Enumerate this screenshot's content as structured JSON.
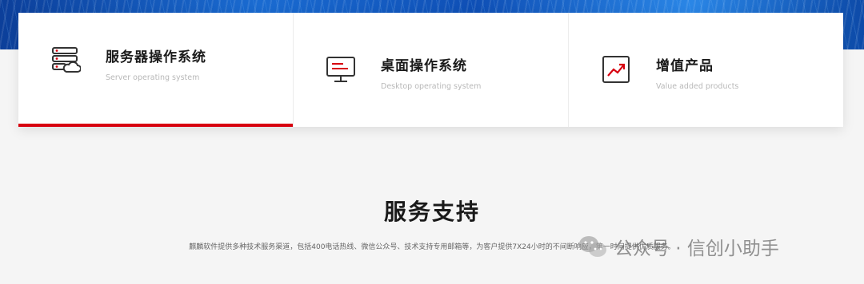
{
  "products": [
    {
      "title": "服务器操作系统",
      "subtitle": "Server operating system",
      "icon": "server-cloud-icon",
      "active": true
    },
    {
      "title": "桌面操作系统",
      "subtitle": "Desktop operating system",
      "icon": "monitor-icon",
      "active": false
    },
    {
      "title": "增值产品",
      "subtitle": "Value added products",
      "icon": "chart-trend-icon",
      "active": false
    }
  ],
  "service": {
    "title": "服务支持",
    "description": "麒麟软件提供多种技术服务渠道，包括400电话热线、微信公众号、技术支持专用邮箱等，为客户提供7X24小时的不间断响应，第一时间提供优质服务。"
  },
  "watermark": {
    "text": "公众号 · 信创小助手",
    "icon": "wechat-icon"
  },
  "colors": {
    "accent": "#d7000f",
    "banner": "#1a6bd1"
  }
}
